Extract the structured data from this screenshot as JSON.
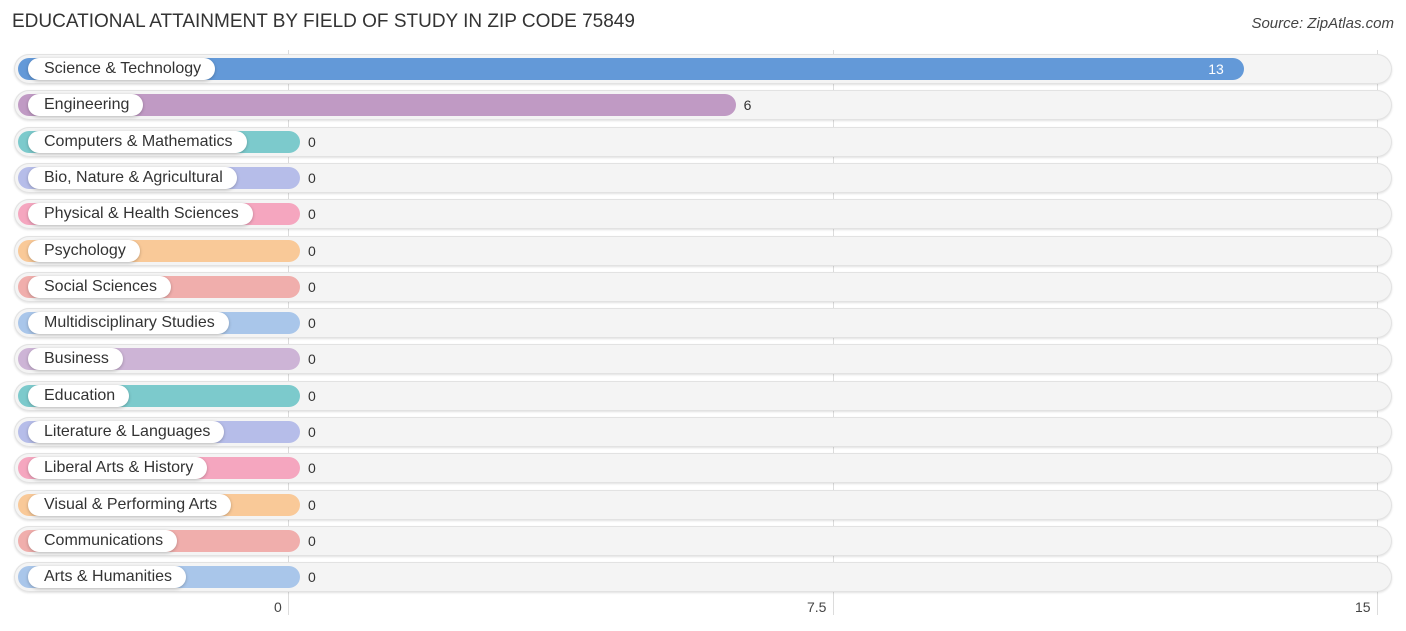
{
  "title": "EDUCATIONAL ATTAINMENT BY FIELD OF STUDY IN ZIP CODE 75849",
  "source": "Source: ZipAtlas.com",
  "chart_data": {
    "type": "bar",
    "orientation": "horizontal",
    "title": "EDUCATIONAL ATTAINMENT BY FIELD OF STUDY IN ZIP CODE 75849",
    "xlabel": "",
    "ylabel": "",
    "xlim": [
      0,
      15
    ],
    "xticks": [
      "0",
      "7.5",
      "15"
    ],
    "grid": true,
    "categories": [
      "Science & Technology",
      "Engineering",
      "Computers & Mathematics",
      "Bio, Nature & Agricultural",
      "Physical & Health Sciences",
      "Psychology",
      "Social Sciences",
      "Multidisciplinary Studies",
      "Business",
      "Education",
      "Literature & Languages",
      "Liberal Arts & History",
      "Visual & Performing Arts",
      "Communications",
      "Arts & Humanities"
    ],
    "values": [
      13,
      6,
      0,
      0,
      0,
      0,
      0,
      0,
      0,
      0,
      0,
      0,
      0,
      0,
      0
    ],
    "value_labels": [
      "13",
      "6",
      "0",
      "0",
      "0",
      "0",
      "0",
      "0",
      "0",
      "0",
      "0",
      "0",
      "0",
      "0",
      "0"
    ],
    "colors": [
      "#6399d8",
      "#c09ac4",
      "#7ccacc",
      "#b6bde9",
      "#f5a6bf",
      "#f9c998",
      "#f0aeac",
      "#a9c6ea",
      "#cdb4d6",
      "#7ccacc",
      "#b6bde9",
      "#f5a6bf",
      "#f9c998",
      "#f0aeac",
      "#a9c6ea"
    ]
  }
}
